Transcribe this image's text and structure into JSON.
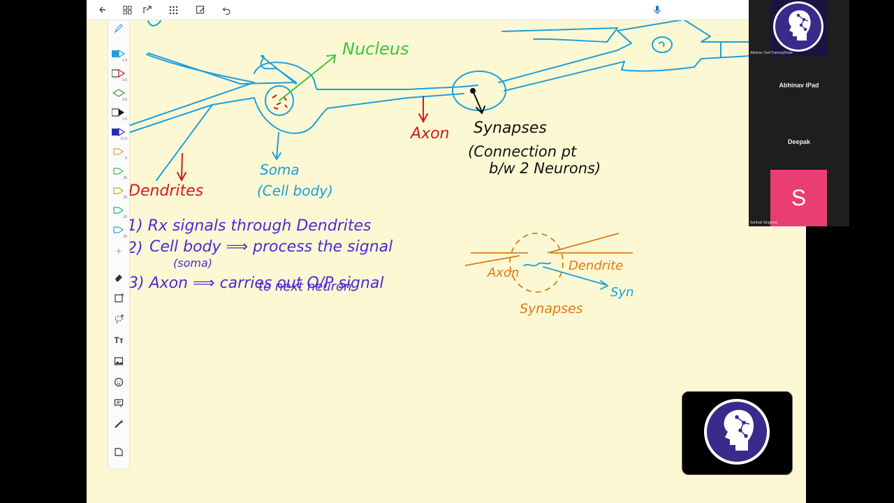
{
  "toolbar": {
    "left_icons": [
      "back-arrow-icon",
      "grid-view-icon",
      "insert-icon",
      "apps-icon",
      "edit-image-icon",
      "undo-icon"
    ],
    "right_icons": [
      "microphone-icon"
    ]
  },
  "tool_rail": {
    "tools": [
      {
        "name": "pen-settings-icon",
        "size": ""
      },
      {
        "name": "pen-blue",
        "size": "1.0"
      },
      {
        "name": "pen-red",
        "size": "0.5"
      },
      {
        "name": "pen-green",
        "size": "2.0"
      },
      {
        "name": "pen-black",
        "size": "1.0"
      },
      {
        "name": "pen-navy",
        "size": "12.0"
      },
      {
        "name": "highlighter-orange",
        "size": "5"
      },
      {
        "name": "highlighter-green",
        "size": "15"
      },
      {
        "name": "highlighter-yellow",
        "size": "20"
      },
      {
        "name": "highlighter-teal",
        "size": "10"
      },
      {
        "name": "highlighter-cyan",
        "size": "30"
      }
    ],
    "bottom_tools": [
      "add-tool-icon",
      "eraser-icon",
      "shape-icon",
      "lasso-icon",
      "text-icon",
      "image-icon",
      "sticker-icon",
      "comment-icon",
      "ruler-icon",
      "page-icon"
    ],
    "text_tool_label": "Tт"
  },
  "notes": {
    "nucleus": "Nucleus",
    "axon_top": "Axon",
    "synapses_title": "Synapses",
    "synapses_line1": "(Connection pt",
    "synapses_line2": "b/w 2 Neurons)",
    "dendrites": "Dendrites",
    "soma": "Soma",
    "cell_body": "(Cell body)",
    "point1": "1) Rx signals through Dendrites",
    "point2_num": "2)",
    "point2": "Cell body ⟹ process the signal",
    "point2_sub": "(soma)",
    "point3": "3) Axon ⟹ carries out O/P signal",
    "point3_sub": "to next neuron",
    "diag_axon": "Axon",
    "diag_dendrite": "Dendrite",
    "diag_syn": "Syn",
    "diag_synapses": "Synapses"
  },
  "participants": [
    {
      "name": "Abhinav TechTrainingShala",
      "type": "logo"
    },
    {
      "name": "Abhinav iPad",
      "type": "name"
    },
    {
      "name": "Deepak",
      "type": "name"
    },
    {
      "name": "Sarthak Singhwal",
      "type": "avatar",
      "initial": "S",
      "color": "#e83e74"
    }
  ],
  "colors": {
    "canvas": "#fdf8d4",
    "blue_ink": "#1aa0dd",
    "red_ink": "#d11a1a",
    "green_ink": "#3cc43c",
    "purple_ink": "#4a2bd8",
    "orange_ink": "#e07a10",
    "black_ink": "#111111"
  }
}
